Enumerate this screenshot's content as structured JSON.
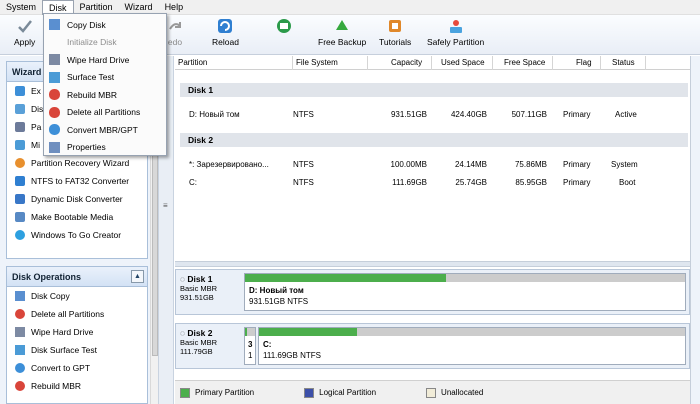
{
  "menubar": [
    "System",
    "Disk",
    "Partition",
    "Wizard",
    "Help"
  ],
  "toolbar": {
    "apply": "Apply",
    "redo": "edo",
    "reload": "Reload",
    "free_backup": "Free Backup",
    "tutorials": "Tutorials",
    "safely_partition": "Safely Partition"
  },
  "disk_menu": [
    {
      "label": "Copy Disk",
      "enabled": true
    },
    {
      "label": "Initialize Disk",
      "enabled": false
    },
    {
      "label": "Wipe Hard Drive",
      "enabled": true
    },
    {
      "label": "Surface Test",
      "enabled": true
    },
    {
      "label": "Rebuild MBR",
      "enabled": true
    },
    {
      "label": "Delete all Partitions",
      "enabled": true
    },
    {
      "label": "Convert MBR/GPT",
      "enabled": true
    },
    {
      "label": "Properties",
      "enabled": true
    }
  ],
  "wizards": {
    "title": "Wizard",
    "items": [
      "Ex",
      "Dis",
      "Pa",
      "Mi",
      "Partition Recovery Wizard",
      "NTFS to FAT32 Converter",
      "Dynamic Disk Converter",
      "Make Bootable Media",
      "Windows To Go Creator"
    ]
  },
  "disk_operations": {
    "title": "Disk Operations",
    "items": [
      "Disk Copy",
      "Delete all Partitions",
      "Wipe Hard Drive",
      "Disk Surface Test",
      "Convert to GPT",
      "Rebuild MBR"
    ]
  },
  "table": {
    "headers": [
      "Partition",
      "File System",
      "Capacity",
      "Used Space",
      "Free Space",
      "Flag",
      "Status"
    ],
    "disk1_label": "Disk 1",
    "disk2_label": "Disk 2",
    "disk1_rows": [
      {
        "partition": "D: Новый том",
        "fs": "NTFS",
        "capacity": "931.51GB",
        "used": "424.40GB",
        "free": "507.11GB",
        "flag": "Primary",
        "status": "Active"
      }
    ],
    "disk2_rows": [
      {
        "partition": "*: Зарезервировано...",
        "fs": "NTFS",
        "capacity": "100.00MB",
        "used": "24.14MB",
        "free": "75.86MB",
        "flag": "Primary",
        "status": "System"
      },
      {
        "partition": "C:",
        "fs": "NTFS",
        "capacity": "111.69GB",
        "used": "25.74GB",
        "free": "85.95GB",
        "flag": "Primary",
        "status": "Boot"
      }
    ]
  },
  "disk_maps": [
    {
      "name": "Disk 1",
      "type": "Basic MBR",
      "size": "931.51GB",
      "partitions": [
        {
          "label": "D: Новый том",
          "detail": "931.51GB NTFS",
          "used_fraction": 0.456
        }
      ]
    },
    {
      "name": "Disk 2",
      "type": "Basic MBR",
      "size": "111.79GB",
      "partitions": [
        {
          "label": "3",
          "detail": "1",
          "used_fraction": 0.24
        },
        {
          "label": "C:",
          "detail": "111.69GB NTFS",
          "used_fraction": 0.23
        }
      ]
    }
  ],
  "legend": [
    "Primary Partition",
    "Logical Partition",
    "Unallocated"
  ],
  "colors": {
    "primary": "#4cae4c",
    "logical": "#3c4fa8",
    "unallocated": "#f1ecd8",
    "disk_row": "#e0e4ea"
  }
}
